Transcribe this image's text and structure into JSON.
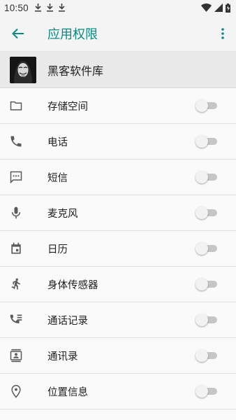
{
  "status_bar": {
    "time": "10:50",
    "download_icons": [
      "download-icon",
      "download-icon",
      "download-icon"
    ],
    "icons": [
      "wifi-icon",
      "signal-icon",
      "battery-icon"
    ]
  },
  "app_bar": {
    "title": "应用权限",
    "back_icon": "arrow-back-icon",
    "menu_icon": "more-vert-icon",
    "accent_color": "#0b8a83"
  },
  "app": {
    "name": "黑客软件库",
    "icon": "app-icon"
  },
  "permissions": [
    {
      "label": "存储空间",
      "icon": "folder-icon",
      "enabled": false
    },
    {
      "label": "电话",
      "icon": "phone-icon",
      "enabled": false
    },
    {
      "label": "短信",
      "icon": "sms-icon",
      "enabled": false
    },
    {
      "label": "麦克风",
      "icon": "microphone-icon",
      "enabled": false
    },
    {
      "label": "日历",
      "icon": "calendar-icon",
      "enabled": false
    },
    {
      "label": "身体传感器",
      "icon": "body-sensor-icon",
      "enabled": false
    },
    {
      "label": "通话记录",
      "icon": "call-log-icon",
      "enabled": false
    },
    {
      "label": "通讯录",
      "icon": "contacts-icon",
      "enabled": false
    },
    {
      "label": "位置信息",
      "icon": "location-icon",
      "enabled": false
    }
  ]
}
